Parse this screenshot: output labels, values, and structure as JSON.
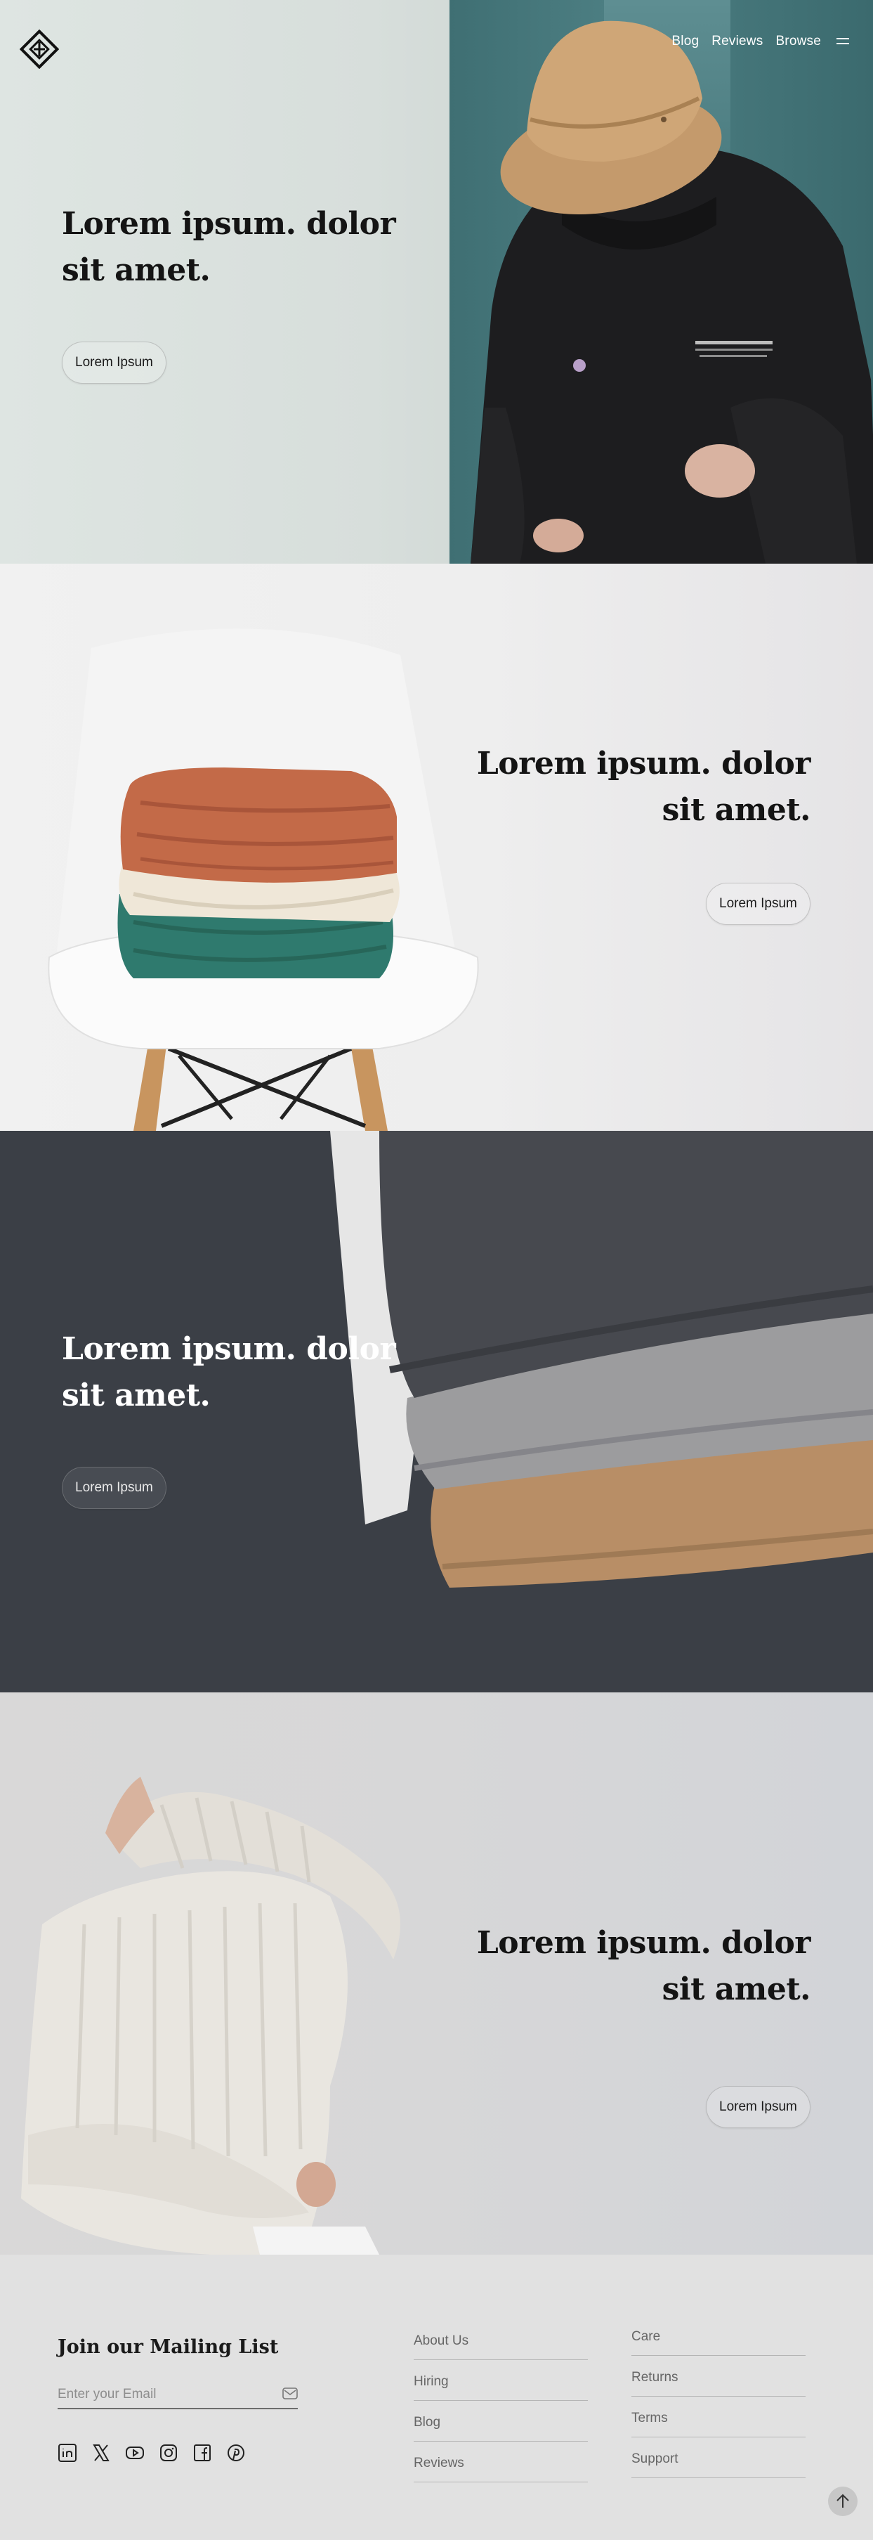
{
  "nav": {
    "links": [
      "Blog",
      "Reviews",
      "Browse"
    ],
    "menu_icon": "hamburger-icon",
    "logo_icon": "diamond-logo-icon"
  },
  "sections": [
    {
      "title_line1": "Lorem ipsum. dolor",
      "title_line2": "sit amet.",
      "button": "Lorem Ipsum"
    },
    {
      "title_line1": "Lorem ipsum. dolor",
      "title_line2": "sit amet.",
      "button": "Lorem Ipsum"
    },
    {
      "title_line1": "Lorem ipsum. dolor",
      "title_line2": "sit amet.",
      "button": "Lorem Ipsum"
    },
    {
      "title_line1": "Lorem ipsum. dolor",
      "title_line2": "sit amet.",
      "button": "Lorem Ipsum"
    }
  ],
  "footer": {
    "mailing_title": "Join our Mailing List",
    "email_placeholder": "Enter your Email",
    "email_icon": "envelope-icon",
    "socials": [
      "linkedin-icon",
      "x-icon",
      "youtube-icon",
      "instagram-icon",
      "facebook-icon",
      "pinterest-icon"
    ],
    "links_col1": [
      "About Us",
      "Hiring",
      "Blog",
      "Reviews"
    ],
    "links_col2": [
      "Care",
      "Returns",
      "Terms",
      "Support"
    ],
    "back_to_top_icon": "arrow-up-icon"
  },
  "colors": {
    "hero1_bg": "#d8dfdc",
    "hero3_bg": "#3b3f46",
    "footer_bg": "#e1e1e1",
    "text_dark": "#141414"
  }
}
